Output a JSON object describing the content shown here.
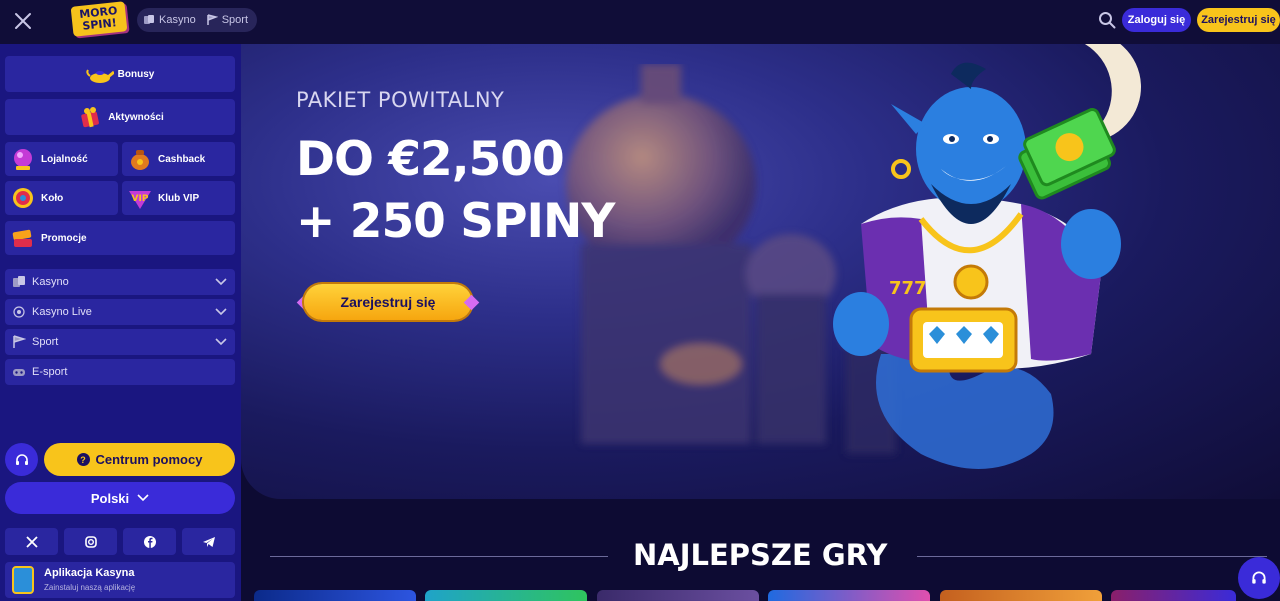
{
  "header": {
    "logo_text": "MORO SPIN!",
    "tabs": [
      {
        "label": "Kasyno",
        "icon": "casino-icon"
      },
      {
        "label": "Sport",
        "icon": "sport-icon"
      }
    ],
    "login_label": "Zaloguj się",
    "register_label": "Zarejestruj się"
  },
  "sidebar": {
    "cards": [
      {
        "label": "Bonusy",
        "icon": "genie-lamp-icon"
      },
      {
        "label": "Aktywności",
        "icon": "gift-icon"
      },
      {
        "label": "Lojalność",
        "icon": "crystal-icon"
      },
      {
        "label": "Cashback",
        "icon": "money-bag-icon"
      },
      {
        "label": "Koło",
        "icon": "wheel-icon"
      },
      {
        "label": "Klub VIP",
        "icon": "vip-icon"
      },
      {
        "label": "Promocje",
        "icon": "promo-icon"
      }
    ],
    "nav": [
      {
        "label": "Kasyno",
        "expandable": true
      },
      {
        "label": "Kasyno Live",
        "expandable": true
      },
      {
        "label": "Sport",
        "expandable": true
      },
      {
        "label": "E-sport",
        "expandable": false
      }
    ],
    "help_label": "Centrum pomocy",
    "language": "Polski",
    "socials": [
      "x-icon",
      "instagram-icon",
      "facebook-icon",
      "telegram-icon"
    ],
    "app": {
      "title": "Aplikacja Kasyna",
      "subtitle": "Zainstaluj naszą aplikację"
    }
  },
  "hero": {
    "subtitle": "PAKIET POWITALNY",
    "title_line1": "DO €2,500",
    "title_line2": "+ 250 SPINY",
    "cta_label": "Zarejestruj się",
    "genie_badge": "777"
  },
  "section": {
    "title": "NAJLEPSZE GRY"
  },
  "colors": {
    "accent_yellow": "#f8c41b",
    "accent_blue": "#3a2bd9",
    "sidebar_bg": "#1a1680",
    "page_bg": "#0d0b33"
  }
}
